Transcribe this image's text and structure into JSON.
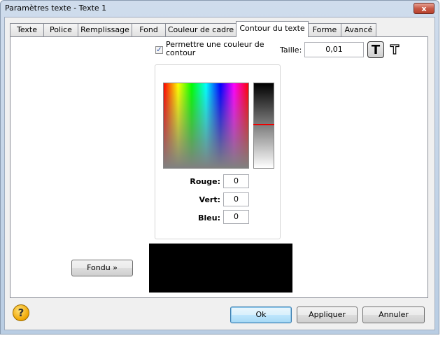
{
  "window": {
    "title": "Paramètres texte - Texte 1",
    "close_glyph": "x"
  },
  "tabs": [
    {
      "label": "Texte"
    },
    {
      "label": "Police"
    },
    {
      "label": "Remplissage"
    },
    {
      "label": "Fond"
    },
    {
      "label": "Couleur de cadre"
    },
    {
      "label": "Contour du texte"
    },
    {
      "label": "Forme"
    },
    {
      "label": "Avancé"
    }
  ],
  "active_tab": "Contour du texte",
  "outline": {
    "checkbox_label": "Permettre une couleur de contour",
    "checkbox_checked": true,
    "size_label": "Taille:",
    "size_value": "0,01",
    "style_bold_glyph": "T",
    "style_outline_glyph": "T"
  },
  "color": {
    "red_label": "Rouge:",
    "red_value": "0",
    "green_label": "Vert:",
    "green_value": "0",
    "blue_label": "Bleu:",
    "blue_value": "0",
    "preview_color": "#000000"
  },
  "fade_button": "Fondu »",
  "buttons": {
    "ok": "Ok",
    "apply": "Appliquer",
    "cancel": "Annuler"
  },
  "icons": {
    "help": "help-question-icon",
    "close": "close-icon"
  }
}
